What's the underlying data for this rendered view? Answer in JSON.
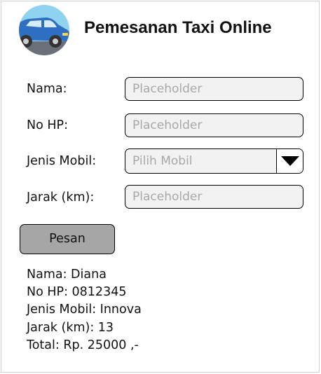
{
  "header": {
    "title": "Pemesanan Taxi Online",
    "logo_icon": "taxi-car-icon"
  },
  "form": {
    "nama": {
      "label": "Nama:",
      "placeholder": "Placeholder",
      "value": ""
    },
    "nohp": {
      "label": "No HP:",
      "placeholder": "Placeholder",
      "value": ""
    },
    "jenis": {
      "label": "Jenis Mobil:",
      "selected": "Pilih Mobil",
      "dropdown_icon": "caret-down-icon"
    },
    "jarak": {
      "label": "Jarak (km):",
      "placeholder": "Placeholder",
      "value": ""
    },
    "submit_label": "Pesan"
  },
  "result": {
    "nama": "Nama: Diana",
    "nohp": "No HP: 0812345",
    "jenis": "Jenis Mobil: Innova",
    "jarak": "Jarak (km): 13",
    "total": "Total: Rp. 25000 ,-"
  },
  "colors": {
    "input_bg": "#f2f2f2",
    "button_bg": "#a6a6a6",
    "logo_bg": "#8fd3f0",
    "car_body": "#2f6fc2"
  }
}
